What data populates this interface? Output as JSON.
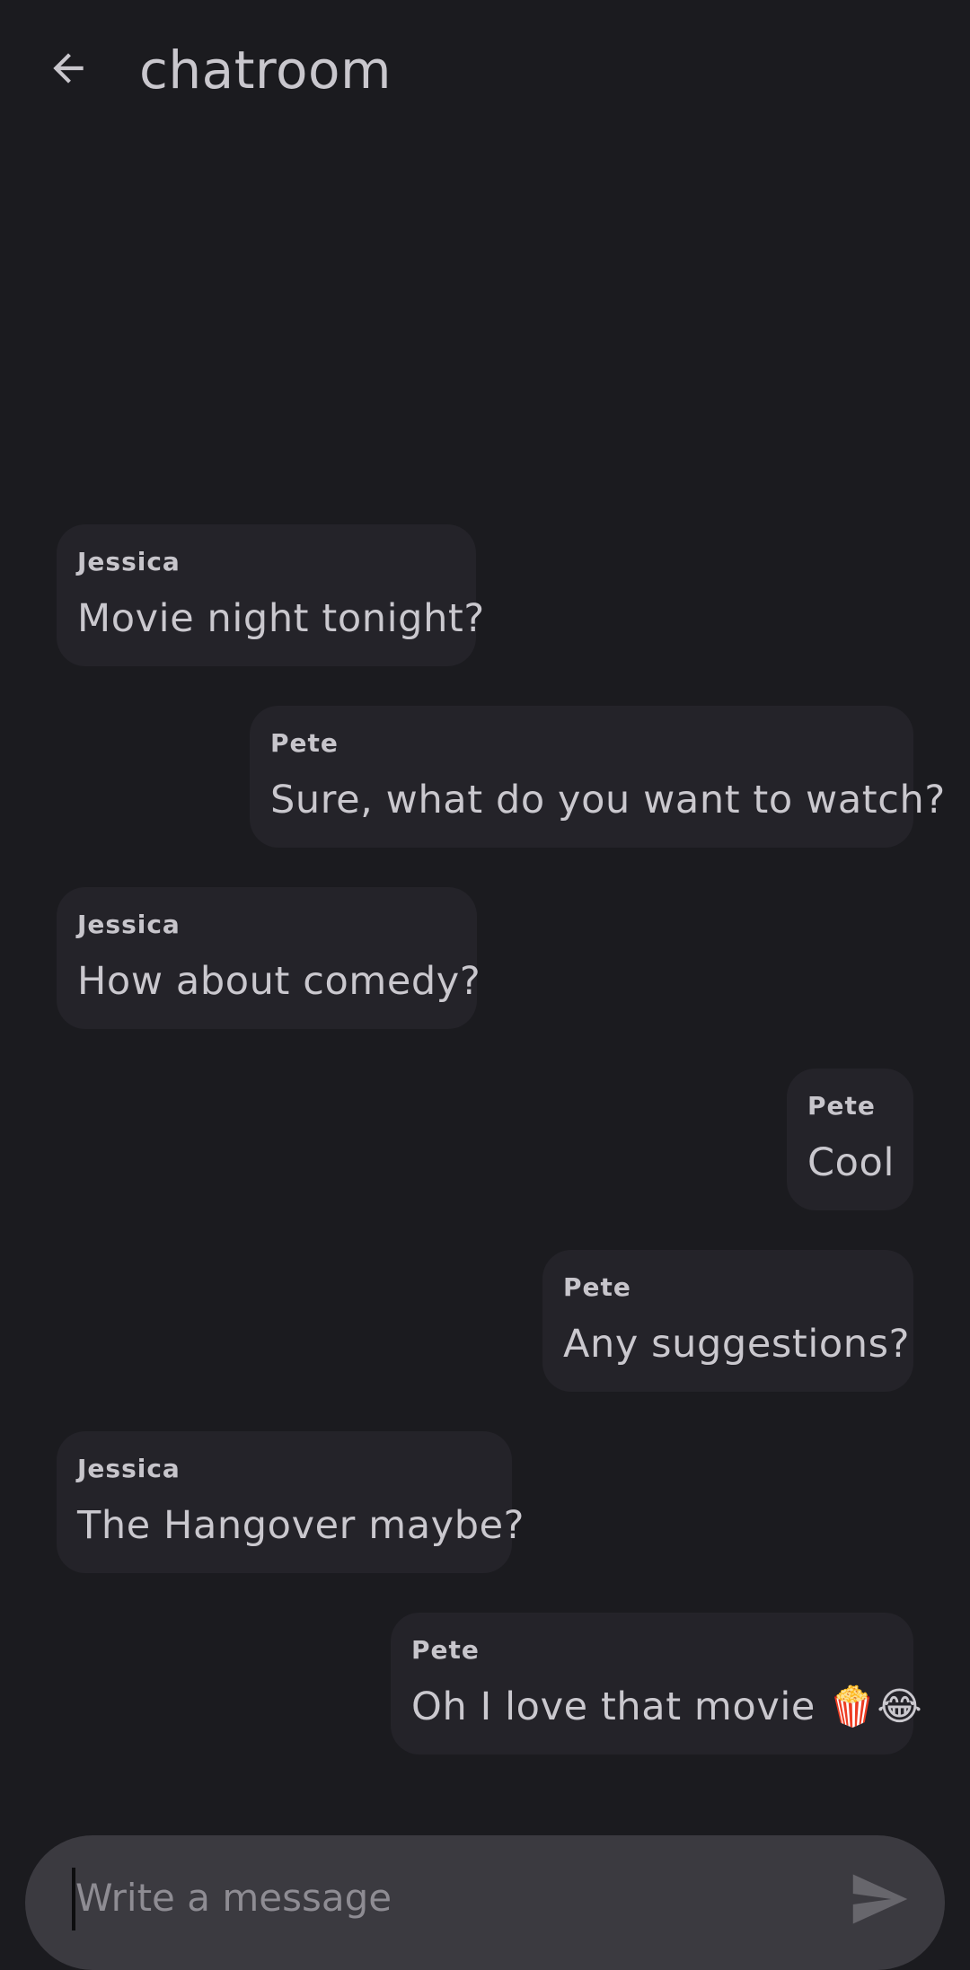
{
  "header": {
    "title": "chatroom",
    "back_icon": "arrow-back-icon"
  },
  "messages": [
    {
      "sender": "Jessica",
      "text": "Movie night tonight?",
      "side": "left"
    },
    {
      "sender": "Pete",
      "text": "Sure, what do you want to watch?",
      "side": "right"
    },
    {
      "sender": "Jessica",
      "text": "How about comedy?",
      "side": "left"
    },
    {
      "sender": "Pete",
      "text": "Cool",
      "side": "right"
    },
    {
      "sender": "Pete",
      "text": "Any suggestions?",
      "side": "right"
    },
    {
      "sender": "Jessica",
      "text": "The Hangover maybe?",
      "side": "left"
    },
    {
      "sender": "Pete",
      "text": "Oh I love that movie 🍿😂",
      "side": "right"
    }
  ],
  "composer": {
    "placeholder": "Write a message",
    "value": "",
    "send_icon": "send-icon"
  },
  "colors": {
    "background": "#1b1b1f",
    "bubble": "#242329",
    "composer": "#3b3a40",
    "text": "#cac8ce"
  }
}
